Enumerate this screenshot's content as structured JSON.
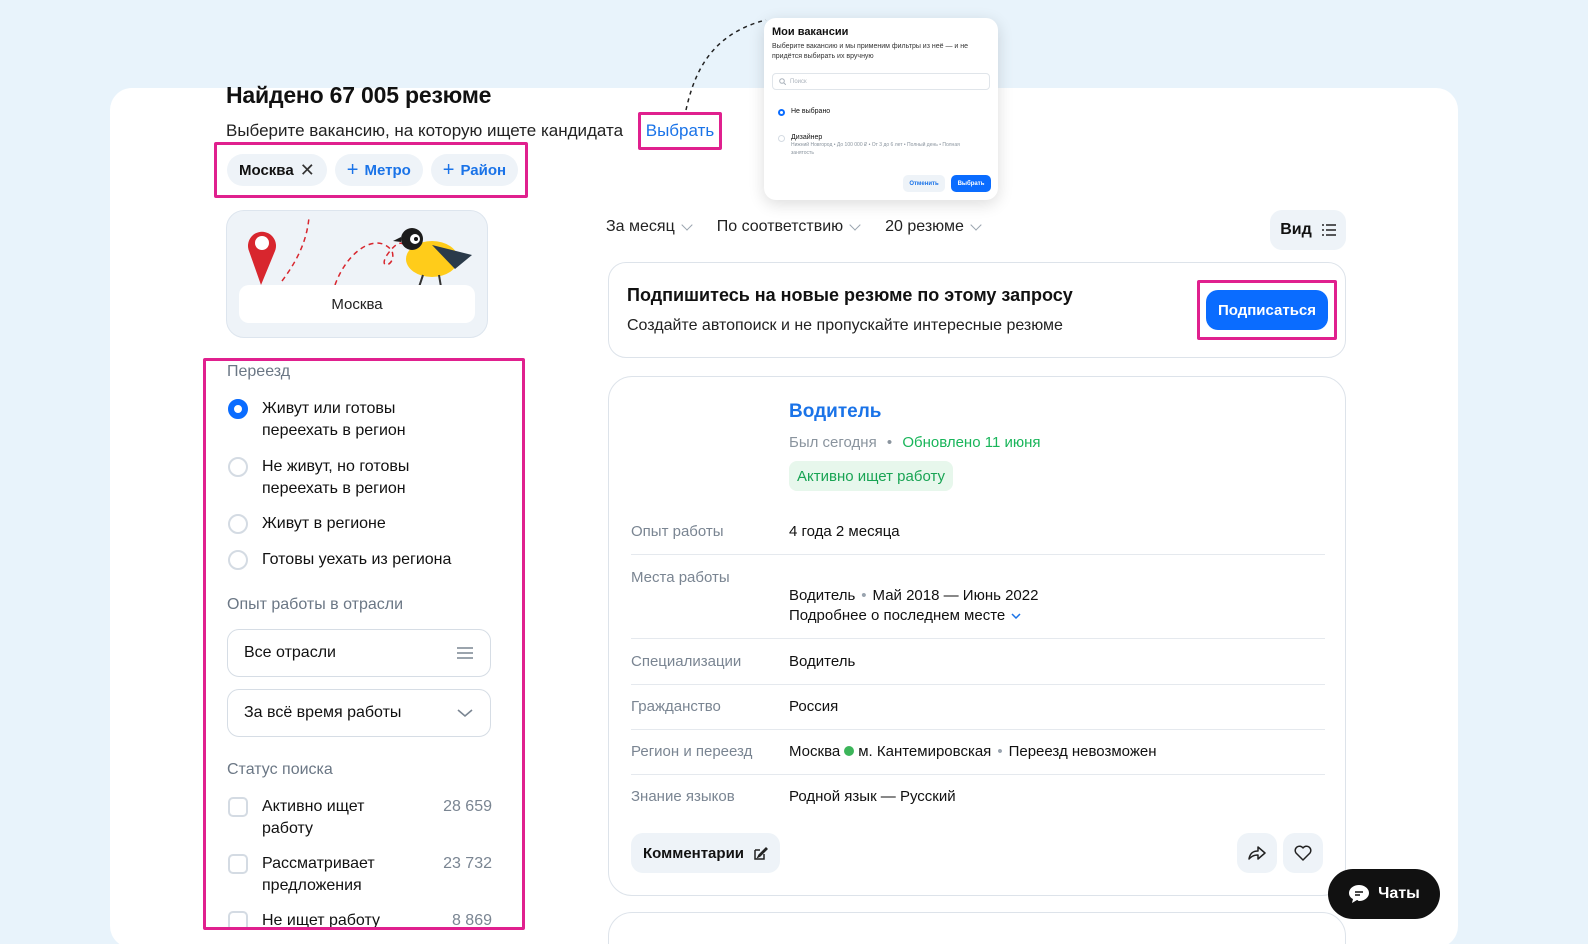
{
  "header": {
    "title": "Найдено 67 005 резюме",
    "subtitle": "Выберите вакансию, на которую ищете кандидата",
    "choose_link": "Выбрать"
  },
  "chips": {
    "city": "Москва",
    "metro": "Метро",
    "district": "Район"
  },
  "map": {
    "label": "Москва"
  },
  "filters": {
    "relocation": {
      "heading": "Переезд",
      "options": [
        {
          "label": "Живут или готовы переехать в регион",
          "checked": true
        },
        {
          "label": "Не живут, но готовы переехать в регион",
          "checked": false
        },
        {
          "label": "Живут в регионе",
          "checked": false
        },
        {
          "label": "Готовы уехать из региона",
          "checked": false
        }
      ]
    },
    "industry": {
      "heading": "Опыт работы в отрасли",
      "industries_value": "Все отрасли",
      "period_value": "За всё время работы"
    },
    "search_status": {
      "heading": "Статус поиска",
      "options": [
        {
          "label": "Активно ищет работу",
          "count": "28 659"
        },
        {
          "label": "Рассматривает предложения",
          "count": "23 732"
        },
        {
          "label": "Не ищет работу",
          "count": "8 869"
        }
      ]
    }
  },
  "sort_bar": {
    "period": "За месяц",
    "order": "По соответствию",
    "per_page": "20 резюме",
    "view": "Вид"
  },
  "subscribe": {
    "title": "Подпишитесь на новые резюме по этому запросу",
    "text": "Создайте автопоиск и не пропускайте интересные резюме",
    "button": "Подписаться"
  },
  "resume": {
    "title": "Водитель",
    "last_seen": "Был сегодня",
    "updated": "Обновлено 11 июня",
    "badge": "Активно ищет работу",
    "rows": {
      "experience_label": "Опыт работы",
      "experience_value": "4 года 2 месяца",
      "places_label": "Места работы",
      "places_position": "Водитель",
      "places_period": "Май 2018 — Июнь 2022",
      "places_more": "Подробнее о последнем месте",
      "spec_label": "Специализации",
      "spec_value": "Водитель",
      "citizenship_label": "Гражданство",
      "citizenship_value": "Россия",
      "region_label": "Регион и переезд",
      "region_city": "Москва",
      "region_metro": "м. Кантемировская",
      "region_relocation": "Переезд невозможен",
      "languages_label": "Знание языков",
      "languages_value": "Родной язык — Русский"
    },
    "comments_button": "Комментарии"
  },
  "chats_button": "Чаты",
  "popup": {
    "title": "Мои вакансии",
    "description": "Выберите вакансию и мы применим фильтры из неё — и не придётся выбирать их вручную",
    "search_placeholder": "Поиск",
    "option_none": "Не выбрано",
    "option_vacancy": "Дизайнер",
    "option_vacancy_details": "Нижний Новгород • До 100 000 ₽ • От 3 до 6 лет • Полный день • Полная занятость",
    "cancel": "Отменить",
    "confirm": "Выбрать"
  },
  "colors": {
    "accent": "#0a6cff",
    "link": "#1a73e8",
    "highlight": "#e0208e",
    "success": "#19b55a",
    "background": "#e8f3fb"
  }
}
